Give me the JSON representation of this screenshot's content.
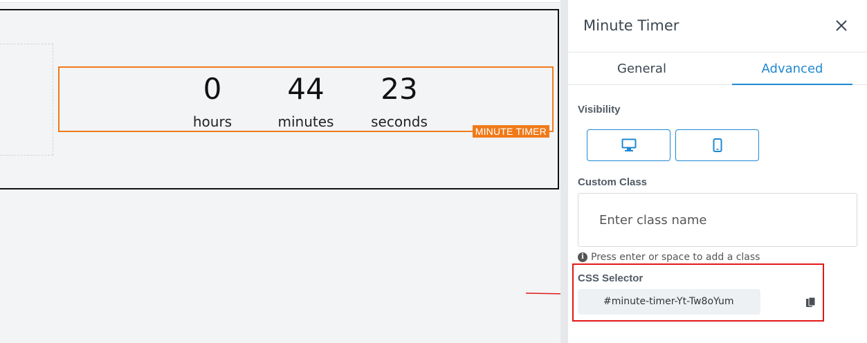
{
  "timer": {
    "hours_value": "0",
    "hours_label": "hours",
    "minutes_value": "44",
    "minutes_label": "minutes",
    "seconds_value": "23",
    "seconds_label": "seconds",
    "widget_tag": "MINUTE TIMER"
  },
  "panel": {
    "title": "Minute Timer",
    "close_icon": "close-icon",
    "tabs": [
      {
        "label": "General",
        "active": false
      },
      {
        "label": "Advanced",
        "active": true
      }
    ],
    "visibility": {
      "label": "Visibility",
      "options": [
        {
          "icon": "desktop-icon"
        },
        {
          "icon": "mobile-icon"
        }
      ]
    },
    "custom_class": {
      "label": "Custom Class",
      "placeholder": "Enter class name",
      "hint": "Press enter or space to add a class"
    },
    "css_selector": {
      "label": "CSS Selector",
      "value": "#minute-timer-Yt-Tw8oYum",
      "copy_icon": "copy-icon"
    }
  },
  "colors": {
    "accent": "#1e88d2",
    "widget_outline": "#f07a1a",
    "highlight": "#e01818"
  }
}
